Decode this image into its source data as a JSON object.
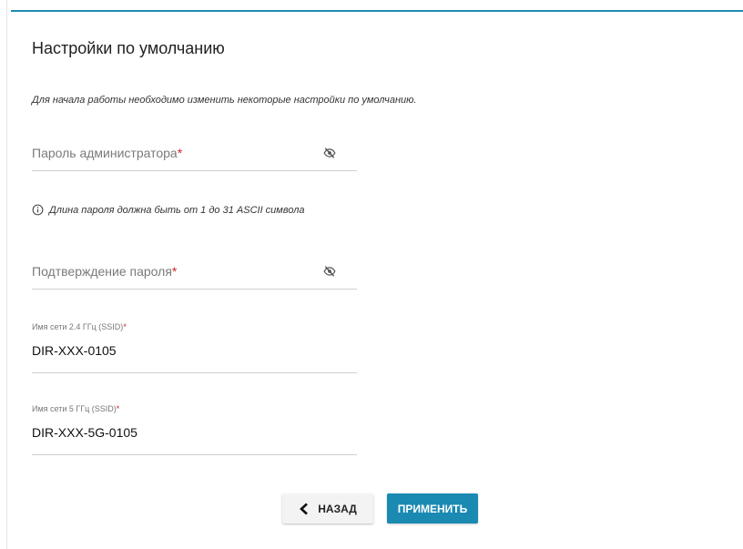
{
  "page": {
    "title": "Настройки по умолчанию",
    "intro": "Для начала работы необходимо изменить некоторые настройки по умолчанию."
  },
  "form": {
    "admin_password": {
      "placeholder": "Пароль администратора",
      "required_mark": "*",
      "value": ""
    },
    "password_hint": "Длина пароля должна быть от 1 до 31 ASCII символа",
    "confirm_password": {
      "placeholder": "Подтверждение пароля",
      "required_mark": "*",
      "value": ""
    },
    "ssid_24": {
      "label": "Имя сети 2.4 ГГц (SSID)",
      "required_mark": "*",
      "value": "DIR-XXX-0105"
    },
    "ssid_5": {
      "label": "Имя сети 5 ГГц (SSID)",
      "required_mark": "*",
      "value": "DIR-XXX-5G-0105"
    }
  },
  "buttons": {
    "back_label": "НАЗАД",
    "apply_label": "ПРИМЕНИТЬ"
  },
  "icons": {
    "password_toggle": "eye-off-icon",
    "hint": "info-icon",
    "back": "chevron-left-icon"
  },
  "colors": {
    "accent": "#1a8ab3",
    "required": "#d02525",
    "field_border": "#cfcfcf"
  }
}
